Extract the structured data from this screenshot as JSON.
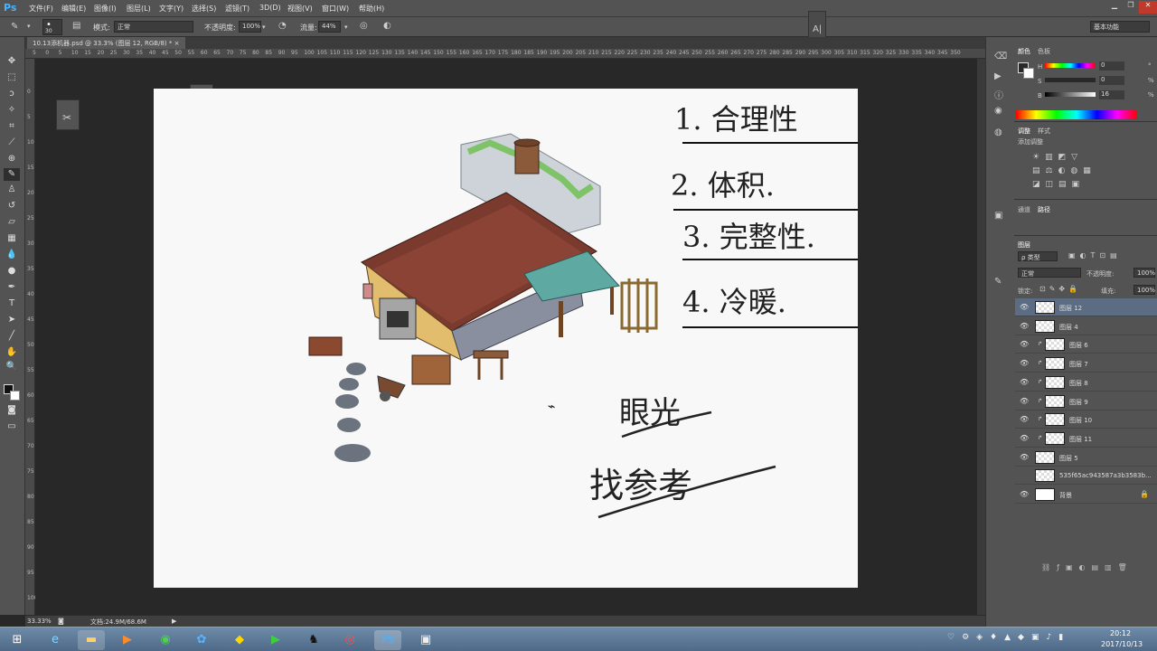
{
  "app": {
    "logo": "Ps",
    "title_buttons": [
      "▁",
      "❐",
      "✕"
    ]
  },
  "menu": [
    "文件(F)",
    "编辑(E)",
    "图像(I)",
    "图层(L)",
    "文字(Y)",
    "选择(S)",
    "滤镜(T)",
    "3D(D)",
    "视图(V)",
    "窗口(W)",
    "帮助(H)"
  ],
  "options": {
    "brush_size": "30",
    "mode_label": "模式:",
    "mode_value": "正常",
    "opacity_label": "不透明度:",
    "opacity_value": "100%",
    "flow_label": "流量:",
    "flow_value": "44%",
    "workspace": "基本功能"
  },
  "document": {
    "tab": "10.13添机器.psd @ 33.3% (图层 12, RGB/8) *"
  },
  "ruler_h": [
    "5",
    "0",
    "5",
    "10",
    "15",
    "20",
    "25",
    "30",
    "35",
    "40",
    "45",
    "50",
    "55",
    "60",
    "65",
    "70",
    "75",
    "80",
    "85",
    "90",
    "95",
    "100",
    "105",
    "110",
    "115",
    "120",
    "125",
    "130",
    "135",
    "140",
    "145",
    "150",
    "155",
    "160",
    "165",
    "170",
    "175",
    "180",
    "185",
    "190",
    "195",
    "200",
    "205",
    "210",
    "215",
    "220",
    "225",
    "230",
    "235",
    "240",
    "245",
    "250",
    "255",
    "260",
    "265",
    "270",
    "275",
    "280",
    "285",
    "290",
    "295",
    "300",
    "305",
    "310",
    "315",
    "320",
    "325",
    "330",
    "335",
    "340",
    "345",
    "350"
  ],
  "ruler_v": [
    "0",
    "5",
    "10",
    "15",
    "20",
    "25",
    "30",
    "35",
    "40",
    "45",
    "50",
    "55",
    "60",
    "65",
    "70",
    "75",
    "80",
    "85",
    "90",
    "95",
    "100",
    "105"
  ],
  "canvas_text": {
    "line1": "1. 合理性",
    "line2": "2. 体积.",
    "line3": "3. 完整性.",
    "line4": "4. 冷暖.",
    "eye": "眼光",
    "ref": "找参考"
  },
  "status": {
    "zoom": "33.33%",
    "doc": "文档:24.9M/68.6M"
  },
  "color_panel": {
    "tab1": "颜色",
    "tab2": "色板",
    "h_label": "H",
    "h_value": "0",
    "s_label": "S",
    "s_value": "0",
    "b_label": "B",
    "b_value": "16",
    "h_unit": "°",
    "pct": "%"
  },
  "adjust_panel": {
    "tab1": "调整",
    "tab2": "样式",
    "add_label": "添加调整"
  },
  "path_panel": {
    "tab1": "通道",
    "tab2": "路径"
  },
  "layers_panel": {
    "tab": "图层",
    "filter": "ρ 类型",
    "blend": "正常",
    "opacity_label": "不透明度:",
    "opacity_value": "100%",
    "lock_label": "锁定:",
    "fill_label": "填充:",
    "fill_value": "100%",
    "layers": [
      {
        "name": "图层 12",
        "indent": false,
        "selected": true,
        "visible": true
      },
      {
        "name": "图层 4",
        "indent": false,
        "selected": false,
        "visible": true
      },
      {
        "name": "图层 6",
        "indent": true,
        "selected": false,
        "visible": true
      },
      {
        "name": "图层 7",
        "indent": true,
        "selected": false,
        "visible": true
      },
      {
        "name": "图层 8",
        "indent": true,
        "selected": false,
        "visible": true
      },
      {
        "name": "图层 9",
        "indent": true,
        "selected": false,
        "visible": true
      },
      {
        "name": "图层 10",
        "indent": true,
        "selected": false,
        "visible": true
      },
      {
        "name": "图层 11",
        "indent": true,
        "selected": false,
        "visible": true
      },
      {
        "name": "图层 5",
        "indent": false,
        "selected": false,
        "visible": true
      },
      {
        "name": "535f65ac943587a3b3583b...",
        "indent": false,
        "selected": false,
        "visible": false
      },
      {
        "name": "背景",
        "indent": false,
        "selected": false,
        "visible": true,
        "locked": true
      }
    ]
  },
  "taskbar": {
    "time": "20:12",
    "date": "2017/10/13"
  }
}
